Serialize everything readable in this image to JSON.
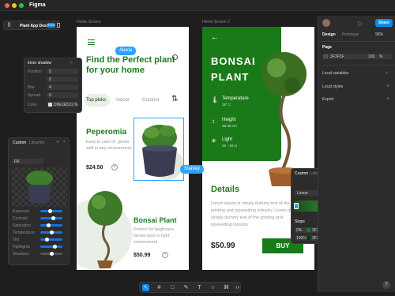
{
  "app": {
    "title": "Figma",
    "project": "Plant App Design",
    "plan_badge": "Free"
  },
  "frames": {
    "home": "Home Screen",
    "home2": "Home Screen 2"
  },
  "home": {
    "heading": "Find the Perfect plant for your home",
    "tabs": [
      "Top picks",
      "Indoor",
      "Outdoor"
    ],
    "cards": [
      {
        "name": "Peperomia",
        "desc": "Easy to care of, grows well in any environment",
        "price": "$24.50"
      },
      {
        "name": "Bonsai Plant",
        "desc": "Perfect for beginners. Grows best in light environment",
        "price": "$50.99"
      }
    ]
  },
  "details": {
    "title": "BONSAI PLANT",
    "specs": [
      {
        "label": "Temperature",
        "value": "18° C"
      },
      {
        "label": "Height",
        "value": "35-38 cm"
      },
      {
        "label": "Light",
        "value": "15 - 18 m"
      }
    ],
    "section": "Details",
    "body": "Lorem ipsum is simply dummy text of the printing and typesetting industry. Lorem ipsum is simply dummy text of the printing and typesetting industry",
    "price": "$50.99",
    "buy": "BUY"
  },
  "cursors": {
    "a": "Alexia",
    "b": "Stanley"
  },
  "inner_shadow": {
    "title": "Inner shadow",
    "rows": [
      {
        "label": "Position",
        "value": "0"
      },
      {
        "label": "",
        "value": "0"
      },
      {
        "label": "Blur",
        "value": "4"
      },
      {
        "label": "Spread",
        "value": "0"
      },
      {
        "label": "Color",
        "value": "D9E1E5",
        "opacity": "31 %"
      }
    ]
  },
  "image_panel": {
    "tabs": [
      "Custom",
      "Libraries"
    ],
    "fill_mode": "Fill",
    "adjustments": [
      "Exposure",
      "Contrast",
      "Saturation",
      "Temperature",
      "Tint",
      "Highlights",
      "Shadows"
    ]
  },
  "color_panel": {
    "tabs": [
      "Custom",
      "Libraries"
    ],
    "type": "Linear",
    "stops_label": "Stops",
    "stops": [
      {
        "pos": "0%",
        "hex": "3F3F3F",
        "opacity": "100",
        "unit": "%"
      },
      {
        "pos": "100%",
        "hex": "3F3F3F",
        "opacity": "100",
        "unit": "%"
      }
    ]
  },
  "right_panel": {
    "tabs": [
      "Design",
      "Prototype"
    ],
    "zoom": "96%",
    "share": "Share",
    "page_label": "Page",
    "page_color": "3F3F3F",
    "page_opacity": "100",
    "page_unit": "%",
    "sections": [
      "Local variables",
      "Local styles",
      "Export"
    ]
  },
  "help": "?",
  "colors": {
    "accent": "#0c8ce9",
    "brand_green": "#1f7a1f",
    "cursor": "#2ba3ff"
  }
}
